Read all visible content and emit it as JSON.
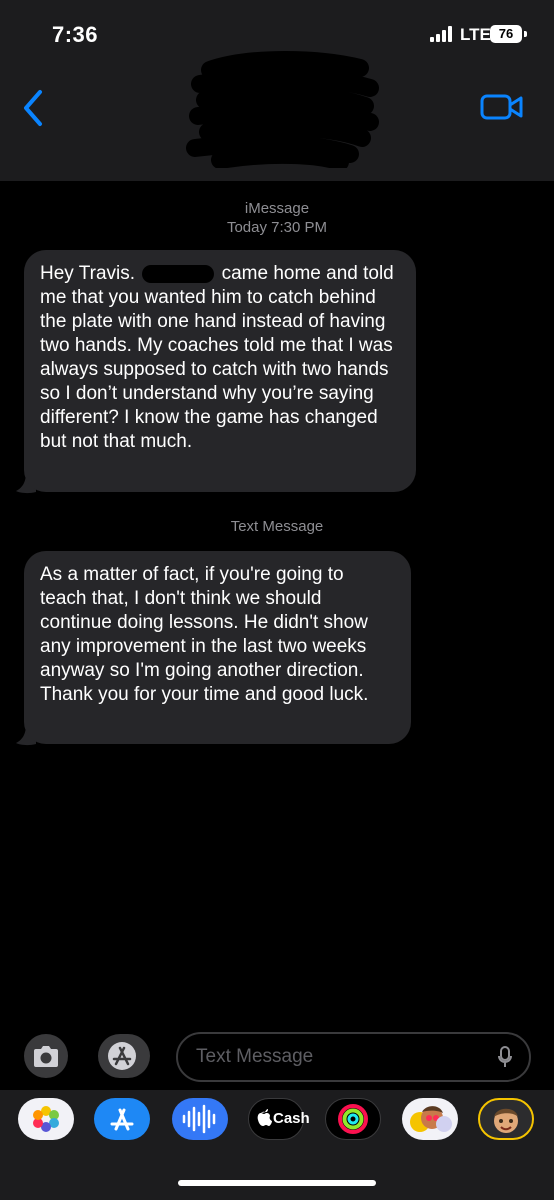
{
  "status_bar": {
    "time": "7:36",
    "network": "LTE",
    "battery": "76"
  },
  "thread": {
    "service_label": "iMessage",
    "timestamp": "Today 7:30 PM",
    "sms_label": "Text Message"
  },
  "messages": [
    {
      "part1": "Hey Travis.",
      "part2": "came home and told me that you wanted him to catch behind the plate with one hand instead of having two hands. My coaches told me that I was always supposed to catch with two hands so I don’t understand why you’re saying different? I know the game has changed but not that much."
    },
    {
      "text": "As a matter of fact, if you're going to teach that, I don't think we should continue doing lessons. He didn't show any improvement in the last two weeks anyway so I'm going another direction. Thank you for your time and good luck."
    }
  ],
  "composer": {
    "placeholder": "Text Message"
  },
  "apps_tray": {
    "items": [
      "photos-app",
      "app-store",
      "audio-message",
      "apple-cash",
      "activity",
      "memoji-stickers",
      "memoji"
    ],
    "cash_label": "Cash"
  },
  "colors": {
    "accent": "#0a84ff",
    "bubble": "#262629",
    "header": "#1c1c1e"
  }
}
